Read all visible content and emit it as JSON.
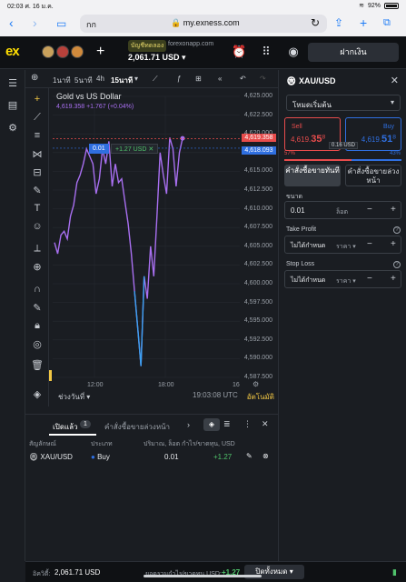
{
  "status": {
    "time": "02:03",
    "date": "ศ. 16 ม.ค.",
    "battery": "92%"
  },
  "browser": {
    "url": "my.exness.com",
    "aa": "กก"
  },
  "header": {
    "logo": "ex",
    "account_badge": "บัญชีทดลอง",
    "account_server": "forexonapp.com",
    "balance": "2,061.71 USD",
    "deposit_label": "ฝากเงิน"
  },
  "chart_toolbar": {
    "timeframes": [
      "1นาที",
      "5นาที",
      "4h",
      "15นาที"
    ],
    "active_timeframe": "15นาที"
  },
  "chart": {
    "title": "Gold vs US Dollar",
    "subtitle": "4,619.358 +1.767 (+0.04%)",
    "y_ticks": [
      "4,625.000",
      "4,622.500",
      "4,620.000",
      "4,617.500",
      "4,615.000",
      "4,612.500",
      "4,610.000",
      "4,607.500",
      "4,605.000",
      "4,602.500",
      "4,600.000",
      "4,597.500",
      "4,595.000",
      "4,592.500",
      "4,590.000",
      "4,587.500"
    ],
    "x_ticks": [
      "12:00",
      "18:00",
      "16"
    ],
    "sell_price_tag": "4,619.358",
    "buy_price_tag": "4,618.093",
    "position_lot": "0.01",
    "position_pnl": "+1.27 USD",
    "range_label": "ช่วงวันที่",
    "clock": "19:03:08 UTC",
    "auto_label": "อัตโนมัติ"
  },
  "chart_data": {
    "type": "line",
    "title": "Gold vs US Dollar",
    "ylim": [
      4587.5,
      4625
    ],
    "values": [
      4605.5,
      4604,
      4606.5,
      4607,
      4606,
      4609,
      4610.5,
      4613.5,
      4614.5,
      4616,
      4618,
      4617,
      4616,
      4612,
      4614,
      4618,
      4616,
      4619,
      4613,
      4616,
      4613.5,
      4614,
      4611,
      4608,
      4604,
      4599,
      4594,
      4589,
      4601,
      4598,
      4605,
      4601,
      4609,
      4617.5,
      4614.5,
      4612,
      4619.5,
      4618,
      4613,
      4617.5,
      4619.4
    ],
    "colors": {
      "line": "#a86ff0",
      "dip": "#3aa0f0"
    }
  },
  "right_panel": {
    "symbol": "XAU/USD",
    "mode": "โหมดเริ่มต้น",
    "sell_label": "Sell",
    "sell_price_main": "4,619.",
    "sell_price_big": "35",
    "sell_price_sup": "8",
    "buy_label": "Buy",
    "buy_price_main": "4,619.",
    "buy_price_big": "51",
    "buy_price_sup": "8",
    "spread": "0.16 USD",
    "sentiment_sell": "57%",
    "sentiment_buy": "43%",
    "order_market": "คำสั่งซื้อขายทันที",
    "order_pending": "คำสั่งซื้อขายล่วงหน้า",
    "volume_label": "ขนาด",
    "volume_value": "0.01",
    "volume_unit": "ล็อต",
    "tp_label": "Take Profit",
    "tp_value": "ไม่ได้กำหนด",
    "tp_unit": "ราคา",
    "sl_label": "Stop Loss",
    "sl_value": "ไม่ได้กำหนด",
    "sl_unit": "ราคา"
  },
  "positions": {
    "tab_open": "เปิดแล้ว",
    "tab_open_count": "1",
    "tab_pending": "คำสั่งซื้อขายล่วงหน้า",
    "headers": [
      "สัญลักษณ์",
      "ประเภท",
      "ปริมาณ, ล็อต",
      "กำไร/ขาดทุน, USD"
    ],
    "row": {
      "symbol": "XAU/USD",
      "type": "Buy",
      "volume": "0.01",
      "pnl": "+1.27"
    }
  },
  "footer": {
    "equity_label": "อิควิตี้:",
    "equity_value": "2,061.71 USD",
    "pnl_label": "ยอดรวมกำไร/ขาดทุน USD:",
    "pnl_value": "+1.27",
    "close_all": "ปิดทั้งหมด"
  }
}
